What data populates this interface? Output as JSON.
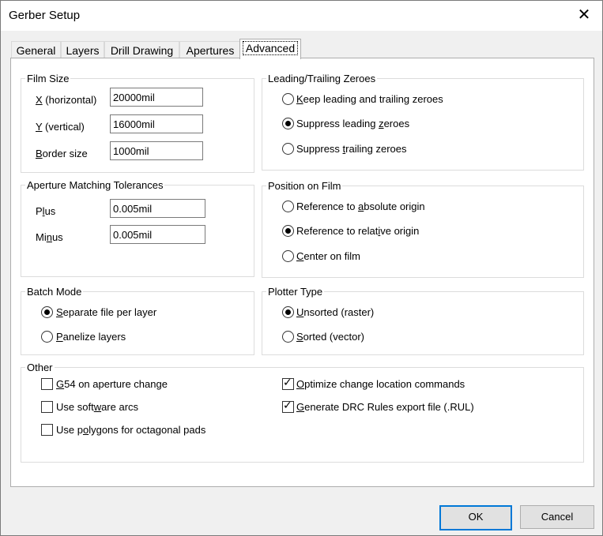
{
  "window": {
    "title": "Gerber Setup",
    "close_symbol": "✕"
  },
  "tabs": [
    {
      "label": "General"
    },
    {
      "label": "Layers"
    },
    {
      "label": "Drill Drawing"
    },
    {
      "label": "Apertures"
    },
    {
      "label": "Advanced",
      "active": true
    }
  ],
  "film_size": {
    "legend": "Film Size",
    "x_label_key": "X",
    "x_label_rest": " (horizontal)",
    "x_value": "20000mil",
    "y_label_key": "Y",
    "y_label_rest": " (vertical)",
    "y_value": "16000mil",
    "border_label_key": "B",
    "border_label_rest": "order size",
    "border_value": "1000mil"
  },
  "aperture": {
    "legend": "Aperture Matching Tolerances",
    "plus_label_a": "P",
    "plus_label_key": "l",
    "plus_label_b": "us",
    "plus_value": "0.005mil",
    "minus_label_a": "Mi",
    "minus_label_key": "n",
    "minus_label_b": "us",
    "minus_value": "0.005mil"
  },
  "batch": {
    "legend": "Batch Mode",
    "opt1_key": "S",
    "opt1_rest": "eparate file per layer",
    "opt2_key": "P",
    "opt2_rest": "anelize layers"
  },
  "zeroes": {
    "legend": "Leading/Trailing Zeroes",
    "opt1_key": "K",
    "opt1_rest": "eep leading and trailing zeroes",
    "opt2_a": "Suppress leading ",
    "opt2_key": "z",
    "opt2_b": "eroes",
    "opt3_a": "Suppress ",
    "opt3_key": "t",
    "opt3_b": "railing zeroes"
  },
  "position": {
    "legend": "Position on Film",
    "opt1_a": "Reference to ",
    "opt1_key": "a",
    "opt1_b": "bsolute origin",
    "opt2_a": "Reference to relat",
    "opt2_key": "i",
    "opt2_b": "ve origin",
    "opt3_key": "C",
    "opt3_rest": "enter on film"
  },
  "plotter": {
    "legend": "Plotter Type",
    "opt1_key": "U",
    "opt1_rest": "nsorted (raster)",
    "opt2_key": "S",
    "opt2_rest": "orted (vector)"
  },
  "other": {
    "legend": "Other",
    "g54_key": "G",
    "g54_rest": "54 on aperture change",
    "soft_a": "Use soft",
    "soft_key": "w",
    "soft_b": "are arcs",
    "poly_a": "Use p",
    "poly_key": "o",
    "poly_b": "lygons for octagonal pads",
    "opt_key": "O",
    "opt_rest": "ptimize change location commands",
    "drc_key": "G",
    "drc_rest": "enerate DRC Rules export file (.RUL)"
  },
  "buttons": {
    "ok": "OK",
    "cancel": "Cancel"
  }
}
